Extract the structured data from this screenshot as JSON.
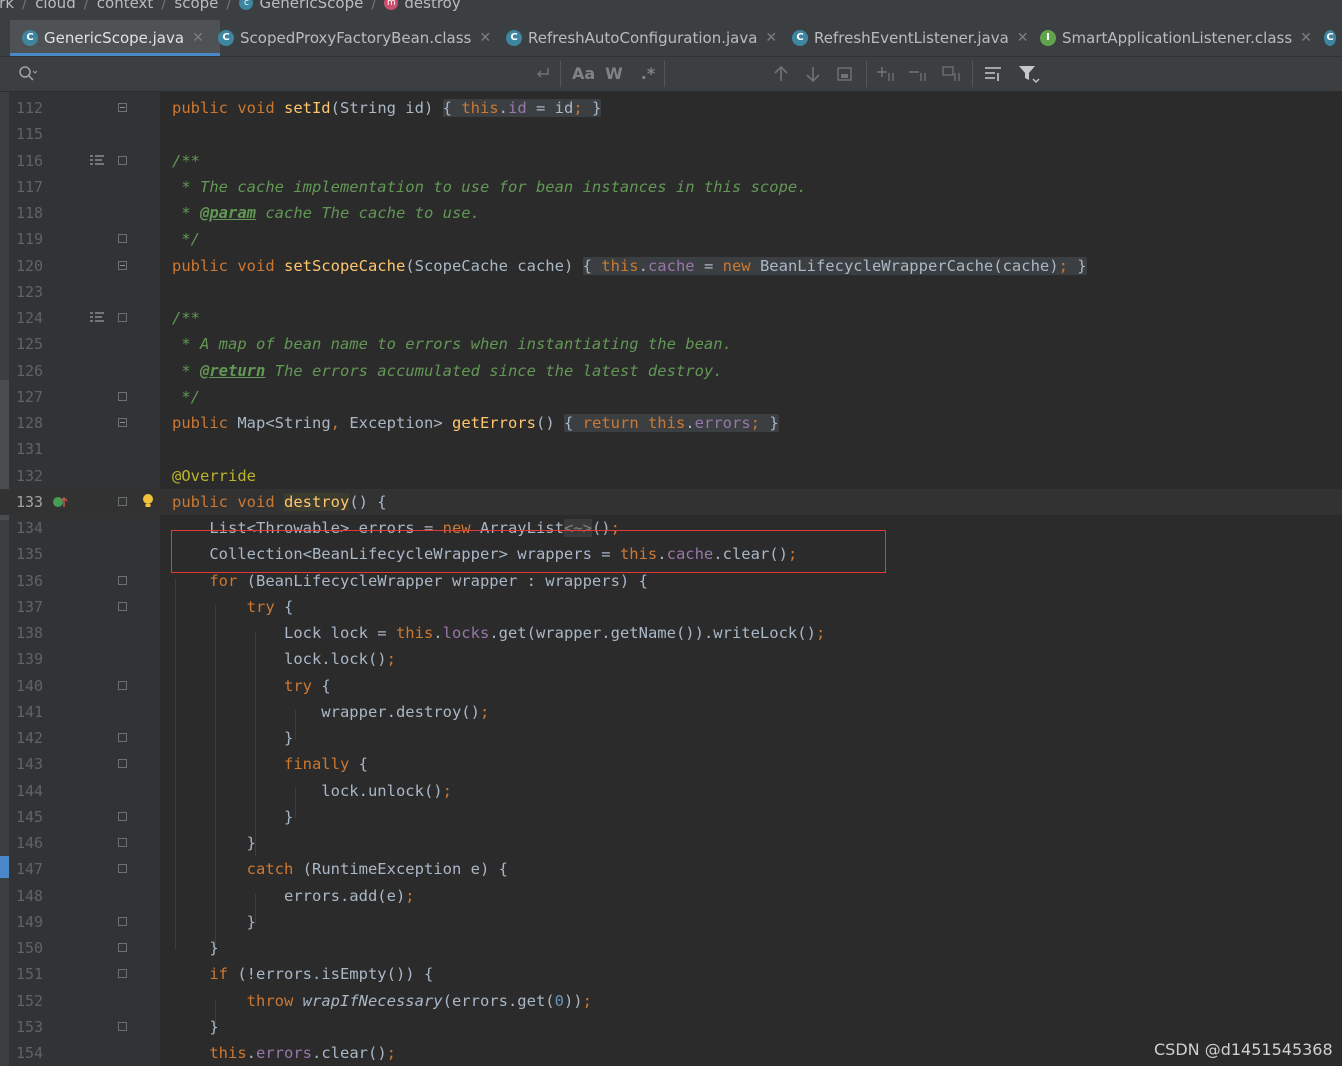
{
  "breadcrumb": {
    "items": [
      "ork",
      "cloud",
      "context",
      "scope",
      "GenericScope",
      "destroy"
    ]
  },
  "tabs": [
    {
      "label": "GenericScope.java",
      "icon": "class-icon",
      "active": true
    },
    {
      "label": "ScopedProxyFactoryBean.class",
      "icon": "class-icon",
      "active": false
    },
    {
      "label": "RefreshAutoConfiguration.java",
      "icon": "class-icon",
      "active": false
    },
    {
      "label": "RefreshEventListener.java",
      "icon": "class-icon",
      "active": false
    },
    {
      "label": "SmartApplicationListener.class",
      "icon": "interface-icon",
      "active": false
    }
  ],
  "find": {
    "query": "",
    "match_case_label": "Aa",
    "words_label": "W",
    "regex_label": ".*"
  },
  "editor": {
    "caret_line": "133",
    "lines": [
      {
        "n": "112"
      },
      {
        "n": "115"
      },
      {
        "n": "116"
      },
      {
        "n": "117"
      },
      {
        "n": "118"
      },
      {
        "n": "119"
      },
      {
        "n": "120"
      },
      {
        "n": "123"
      },
      {
        "n": "124"
      },
      {
        "n": "125"
      },
      {
        "n": "126"
      },
      {
        "n": "127"
      },
      {
        "n": "128"
      },
      {
        "n": "131"
      },
      {
        "n": "132"
      },
      {
        "n": "133"
      },
      {
        "n": "134"
      },
      {
        "n": "135"
      },
      {
        "n": "136"
      },
      {
        "n": "137"
      },
      {
        "n": "138"
      },
      {
        "n": "139"
      },
      {
        "n": "140"
      },
      {
        "n": "141"
      },
      {
        "n": "142"
      },
      {
        "n": "143"
      },
      {
        "n": "144"
      },
      {
        "n": "145"
      },
      {
        "n": "146"
      },
      {
        "n": "147"
      },
      {
        "n": "148"
      },
      {
        "n": "149"
      },
      {
        "n": "150"
      },
      {
        "n": "151"
      },
      {
        "n": "152"
      },
      {
        "n": "153"
      },
      {
        "n": "154"
      }
    ]
  },
  "watermark": "CSDN @d1451545368",
  "colors": {
    "background": "#2b2b2b",
    "keyword": "#cc7832",
    "method": "#ffc66d",
    "field": "#9876aa",
    "comment": "#629755",
    "annotation": "#bbb529",
    "highlight_box": "#e53935",
    "active_tab_underline": "#4a88c7"
  }
}
